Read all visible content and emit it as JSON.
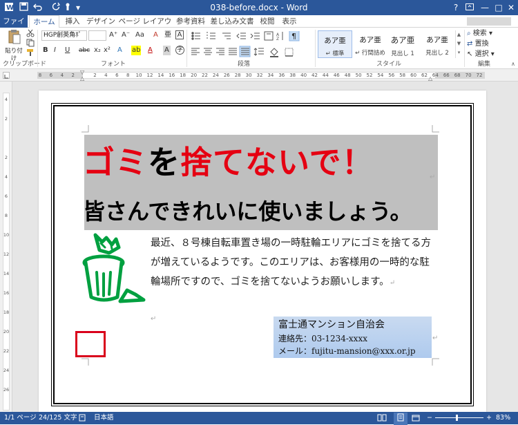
{
  "window": {
    "title": "038-before.docx - Word",
    "help": "?",
    "minimize": "—",
    "maximize": "□",
    "close": "✕"
  },
  "tabs": [
    "ファイル",
    "ホーム",
    "挿入",
    "デザイン",
    "ページ レイアウト",
    "参考資料",
    "差し込み文書",
    "校閲",
    "表示"
  ],
  "ribbon": {
    "clipboard": {
      "paste": "貼り付け",
      "label": "クリップボード"
    },
    "font": {
      "name": "HGP創英角ﾎﾟ",
      "size": "",
      "label": "フォント",
      "grow": "A⁺",
      "shrink": "A⁻",
      "case": "Aa",
      "clear": "A",
      "ruby": "亜",
      "border": "A",
      "bold": "B",
      "italic": "I",
      "underline": "U",
      "strike": "abc",
      "sub": "x₂",
      "sup": "x²",
      "effect": "A",
      "highlight": "ab",
      "color": "A",
      "charshade": "A",
      "enclose": "字"
    },
    "paragraph": {
      "label": "段落"
    },
    "styles": {
      "label": "スタイル",
      "items": [
        {
          "sample": "あア亜",
          "name": "↵ 標準"
        },
        {
          "sample": "あア亜",
          "name": "↵ 行間詰め"
        },
        {
          "sample": "あア亜",
          "name": "見出し 1"
        },
        {
          "sample": "あア亜",
          "name": "見出し 2"
        }
      ]
    },
    "editing": {
      "find": "検索",
      "replace": "置換",
      "select": "選択",
      "label": "編集"
    }
  },
  "ruler": {
    "top": [
      "8",
      "6",
      "4",
      "2",
      "",
      "2",
      "4",
      "6",
      "8",
      "10",
      "12",
      "14",
      "16",
      "18",
      "20",
      "22",
      "24",
      "26",
      "28",
      "30",
      "32",
      "34",
      "36",
      "38",
      "40",
      "42",
      "44",
      "46",
      "48",
      "50",
      "52",
      "54",
      "56",
      "58",
      "60",
      "62",
      "64",
      "66",
      "68",
      "70",
      "72"
    ],
    "left": [
      "4",
      "2",
      "",
      "2",
      "4",
      "6",
      "8",
      "10",
      "12",
      "14",
      "16",
      "18",
      "20",
      "22",
      "24",
      "26"
    ]
  },
  "document": {
    "headline": [
      {
        "text": "ゴミ",
        "color": "red"
      },
      {
        "text": "を",
        "color": "black"
      },
      {
        "text": "捨てないで！",
        "color": "red"
      }
    ],
    "subhead": "皆さんできれいに使いましょう。",
    "body": "最近、８号棟自転車置き場の一時駐輪エリアにゴミを捨てる方が増えているようです。このエリアは、お客様用の一時的な駐輪場所ですので、ゴミを捨てないようお願いします。",
    "contact": {
      "org": "富士通マンション自治会",
      "phone": "連絡先：03-1234-xxxx",
      "mail": "メール：fujitu-mansion@xxx.or.jp"
    },
    "paragraph_mark": "↵"
  },
  "statusbar": {
    "page": "1/1 ページ",
    "words": "24/125 文字",
    "language": "日本語",
    "zoom": "83%"
  },
  "colors": {
    "word_blue": "#2b579a",
    "headline_red": "#e50012",
    "banner_grey": "#bfbfbf",
    "trash_green": "#00a040",
    "box_red": "#d9001b"
  }
}
